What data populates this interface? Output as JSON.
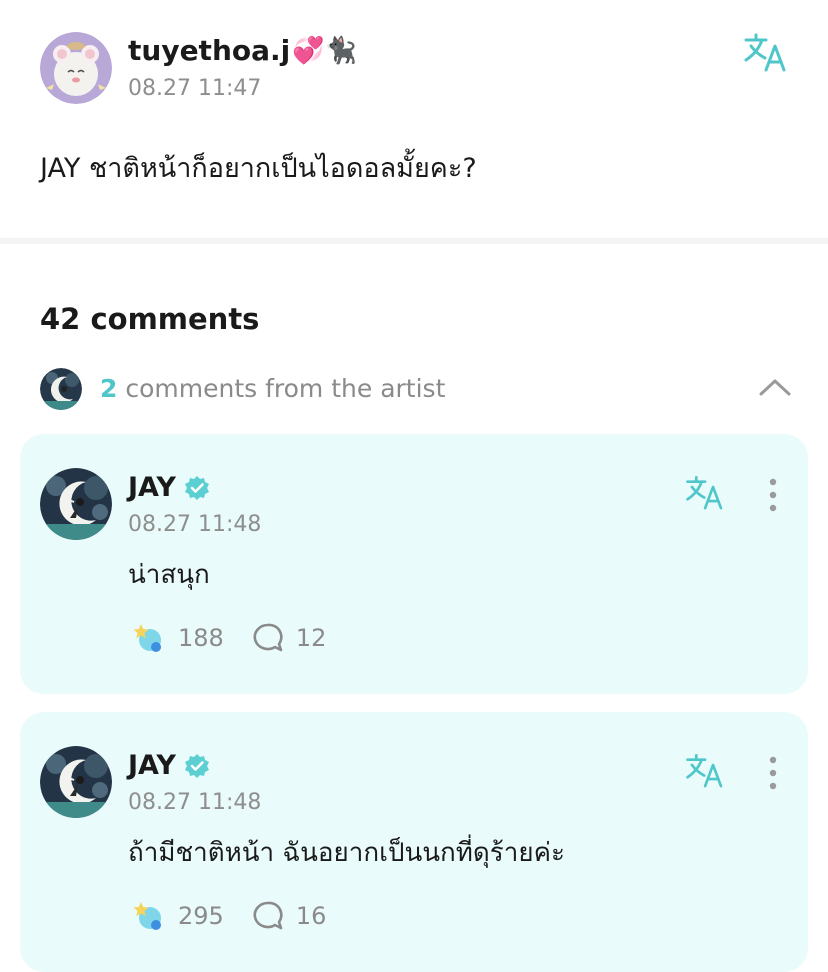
{
  "post": {
    "author": "tuyethoa.j",
    "author_emoji": "💞🐈‍⬛",
    "time": "08.27 11:47",
    "body": "JAY ชาติหน้าก็อยากเป็นไอดอลมั้ยคะ?"
  },
  "comments_header": {
    "label": "42 comments"
  },
  "artist_summary": {
    "count": "2",
    "label": " comments from the artist"
  },
  "artist_comments": [
    {
      "name": "JAY",
      "time": "08.27 11:48",
      "text": "น่าสนุก",
      "reactions": "188",
      "replies": "12"
    },
    {
      "name": "JAY",
      "time": "08.27 11:48",
      "text": "ถ้ามีชาติหน้า ฉันอยากเป็นนกที่ดุร้ายค่ะ",
      "reactions": "295",
      "replies": "16"
    }
  ],
  "colors": {
    "accent": "#4fc6c9",
    "card_background": "#e9fbfa",
    "muted_text": "#8e8e8e"
  },
  "icons": [
    "translate-icon",
    "chevron-up-icon",
    "verified-badge-icon",
    "more-options-icon",
    "reaction-icon",
    "comment-bubble-icon"
  ]
}
